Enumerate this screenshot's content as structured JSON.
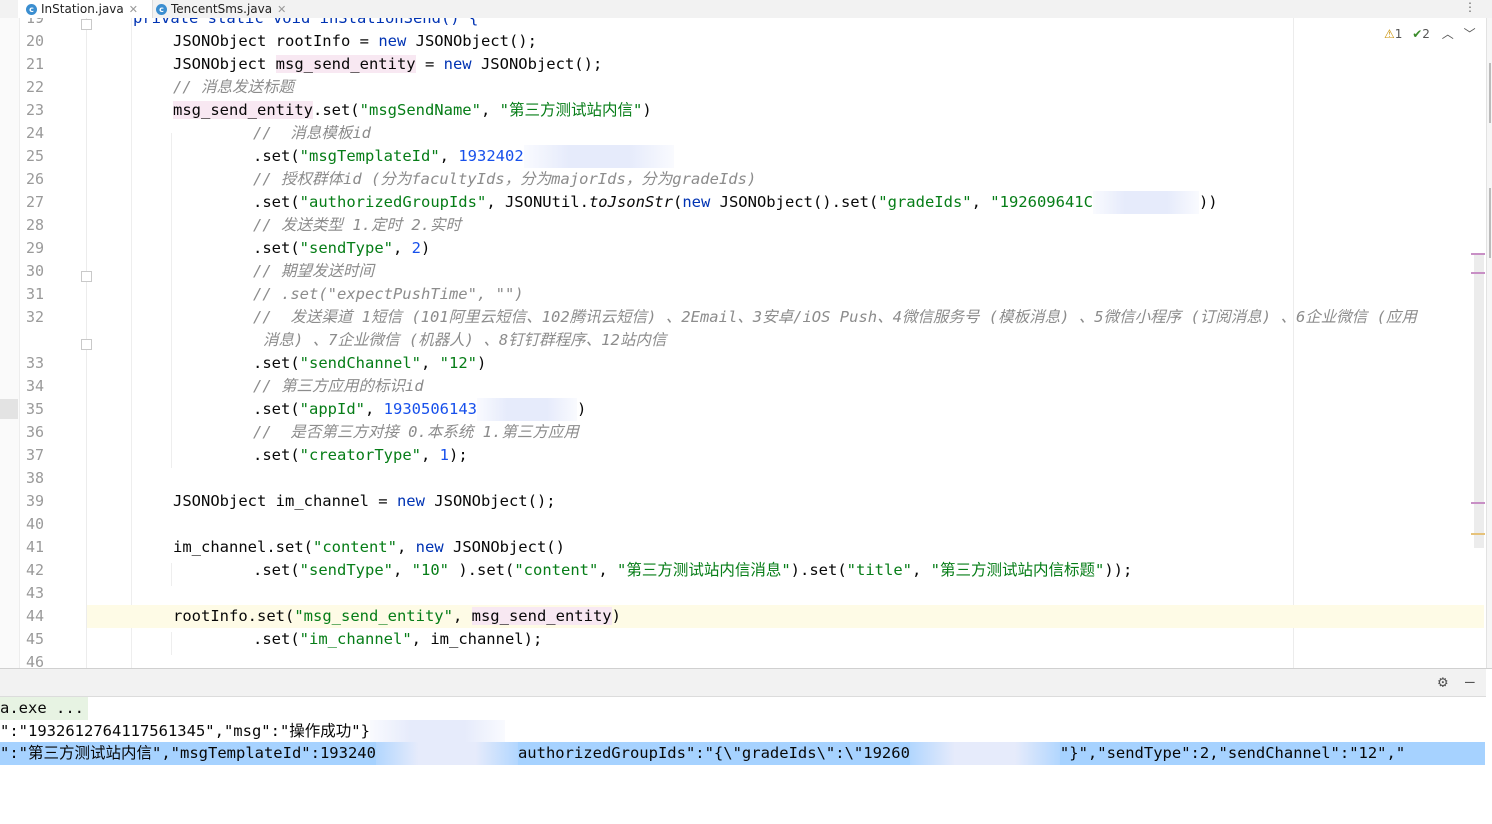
{
  "tabs": [
    {
      "label": "InStation.java",
      "active": true,
      "icon": "java-class-icon"
    },
    {
      "label": "TencentSms.java",
      "active": false,
      "icon": "java-class-icon"
    }
  ],
  "inspection": {
    "warnings": "1",
    "checks": "2"
  },
  "editor": {
    "top_partial": {
      "number": "19",
      "text": "private static void inStationSend() {"
    },
    "numbers": [
      "20",
      "21",
      "22",
      "23",
      "24",
      "25",
      "26",
      "27",
      "28",
      "29",
      "30",
      "31",
      "32",
      "33",
      "34",
      "35",
      "36",
      "37",
      "38",
      "39",
      "40",
      "41",
      "42",
      "43",
      "44",
      "45",
      "46"
    ],
    "code": {
      "l20": {
        "a": "JSONObject rootInfo = ",
        "kw": "new",
        "b": " JSONObject();"
      },
      "l21": {
        "a": "JSONObject ",
        "var": "msg_send_entity",
        "b": " = ",
        "kw": "new",
        "c": " JSONObject();"
      },
      "l22": {
        "cmt": "// 消息发送标题"
      },
      "l23": {
        "var": "msg_send_entity",
        "a": ".set(",
        "s1": "\"msgSendName\"",
        "b": ", ",
        "s2": "\"第三方测试站内信\"",
        "c": ")"
      },
      "l24": {
        "cmt": "//  消息模板id"
      },
      "l25": {
        "a": ".set(",
        "s1": "\"msgTemplateId\"",
        "b": ", ",
        "num": "1932402"
      },
      "l26": {
        "cmt": "// 授权群体id (分为facultyIds，分为majorIds，分为gradeIds)"
      },
      "l27": {
        "a": ".set(",
        "s1": "\"authorizedGroupIds\"",
        "b": ", JSONUtil.",
        "m": "toJsonStr",
        "c": "(",
        "kw": "new",
        "d": " JSONObject().set(",
        "s2": "\"gradeIds\"",
        "e": ", ",
        "s3": "\"192609641C",
        "f": "))"
      },
      "l28": {
        "cmt": "// 发送类型 1.定时 2.实时"
      },
      "l29": {
        "a": ".set(",
        "s1": "\"sendType\"",
        "b": ", ",
        "num": "2",
        "c": ")"
      },
      "l30": {
        "cmt": "// 期望发送时间"
      },
      "l31": {
        "cmt": "// .set(\"expectPushTime\", \"\")"
      },
      "l32": {
        "cmt": "//  发送渠道 1短信 (101阿里云短信、102腾讯云短信) 、2Email、3安卓/iOS Push、4微信服务号 (模板消息) 、5微信小程序 (订阅消息) 、6企业微信 (应用",
        "cmt2": "消息) 、7企业微信 (机器人) 、8钉钉群程序、12站内信"
      },
      "l33": {
        "a": ".set(",
        "s1": "\"sendChannel\"",
        "b": ", ",
        "s2": "\"12\"",
        "c": ")"
      },
      "l34": {
        "cmt": "// 第三方应用的标识id"
      },
      "l35": {
        "a": ".set(",
        "s1": "\"appId\"",
        "b": ", ",
        "num": "1930506143",
        "c": ")"
      },
      "l36": {
        "cmt": "//  是否第三方对接 0.本系统 1.第三方应用"
      },
      "l37": {
        "a": ".set(",
        "s1": "\"creatorType\"",
        "b": ", ",
        "num": "1",
        "c": ");"
      },
      "l39": {
        "a": "JSONObject im_channel = ",
        "kw": "new",
        "b": " JSONObject();"
      },
      "l41": {
        "a": "im_channel.set(",
        "s1": "\"content\"",
        "b": ", ",
        "kw": "new",
        "c": " JSONObject()"
      },
      "l42": {
        "a": ".set(",
        "s1": "\"sendType\"",
        "b": ", ",
        "s2": "\"10\"",
        "c": " ).set(",
        "s3": "\"content\"",
        "d": ", ",
        "s4": "\"第三方测试站内信消息\"",
        "e": ").set(",
        "s5": "\"title\"",
        "f": ", ",
        "s6": "\"第三方测试站内信标题\"",
        "g": "));"
      },
      "l44": {
        "a": "rootInfo.set(",
        "s1": "\"msg_send_entity\"",
        "b": ", ",
        "var": "msg_send_entity",
        "c": ")"
      },
      "l45": {
        "a": ".set(",
        "s1": "\"im_channel\"",
        "b": ", im_channel);"
      }
    }
  },
  "run_output": {
    "l0": "a.exe ...",
    "l1": "\":\"1932612764117561345\",\"msg\":\"操作成功\"}",
    "l2a": "\":\"第三方测试站内信\",\"msgTemplateId\":193240",
    "l2b": "authorizedGroupIds\":\"{\\\"gradeIds\\\":\\\"19260",
    "l2c": "\"}\",\"sendType\":2,\"sendChannel\":\"12\",\""
  },
  "colors": {
    "keyword": "#0033b3",
    "string": "#067d17",
    "comment": "#8c8c8c",
    "number": "#1750eb",
    "field": "#871094",
    "selection": "#a6d2ff"
  }
}
